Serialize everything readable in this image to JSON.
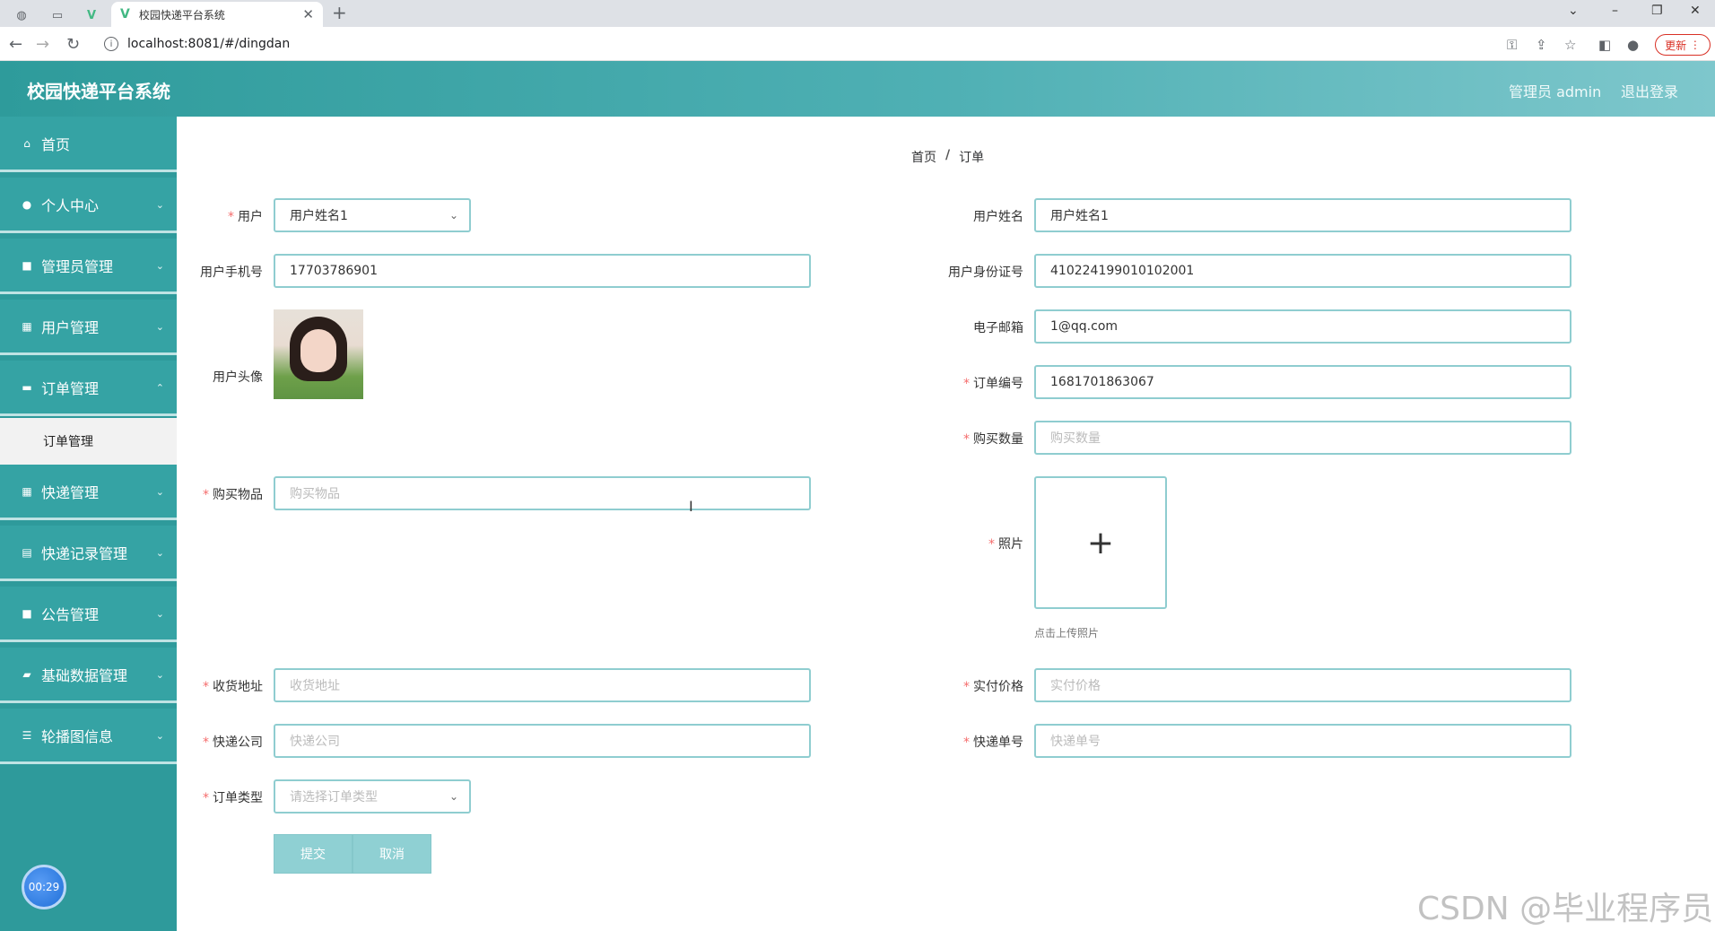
{
  "browser": {
    "tab_title": "校园快递平台系统",
    "url": "localhost:8081/#/dingdan",
    "update_label": "更新"
  },
  "header": {
    "title": "校园快递平台系统",
    "admin_label": "管理员 admin",
    "logout_label": "退出登录"
  },
  "sidebar": {
    "items": [
      {
        "label": "首页",
        "icon": "home-icon"
      },
      {
        "label": "个人中心",
        "icon": "user-icon"
      },
      {
        "label": "管理员管理",
        "icon": "chat-icon"
      },
      {
        "label": "用户管理",
        "icon": "grid-icon"
      },
      {
        "label": "订单管理",
        "icon": "cart-icon"
      },
      {
        "label": "快递管理",
        "icon": "grid-icon"
      },
      {
        "label": "快递记录管理",
        "icon": "doc-icon"
      },
      {
        "label": "公告管理",
        "icon": "chat-icon"
      },
      {
        "label": "基础数据管理",
        "icon": "ticket-icon"
      },
      {
        "label": "轮播图信息",
        "icon": "sliders-icon"
      }
    ],
    "active_submenu": "订单管理",
    "timer": "00:29"
  },
  "breadcrumb": {
    "home": "首页",
    "sep": "/",
    "current": "订单"
  },
  "form": {
    "user": {
      "label": "用户",
      "value": "用户姓名1"
    },
    "user_name": {
      "label": "用户姓名",
      "value": "用户姓名1"
    },
    "user_phone": {
      "label": "用户手机号",
      "value": "17703786901"
    },
    "user_idcard": {
      "label": "用户身份证号",
      "value": "410224199010102001"
    },
    "email": {
      "label": "电子邮箱",
      "value": "1@qq.com"
    },
    "avatar": {
      "label": "用户头像"
    },
    "order_no": {
      "label": "订单编号",
      "value": "1681701863067"
    },
    "quantity": {
      "label": "购买数量",
      "placeholder": "购买数量"
    },
    "item": {
      "label": "购买物品",
      "placeholder": "购买物品"
    },
    "photo": {
      "label": "照片",
      "tip": "点击上传照片"
    },
    "address": {
      "label": "收货地址",
      "placeholder": "收货地址"
    },
    "price": {
      "label": "实付价格",
      "placeholder": "实付价格"
    },
    "company": {
      "label": "快递公司",
      "placeholder": "快递公司"
    },
    "tracking": {
      "label": "快递单号",
      "placeholder": "快递单号"
    },
    "order_type": {
      "label": "订单类型",
      "placeholder": "请选择订单类型"
    },
    "submit_label": "提交",
    "cancel_label": "取消"
  },
  "watermark": "CSDN @毕业程序员"
}
